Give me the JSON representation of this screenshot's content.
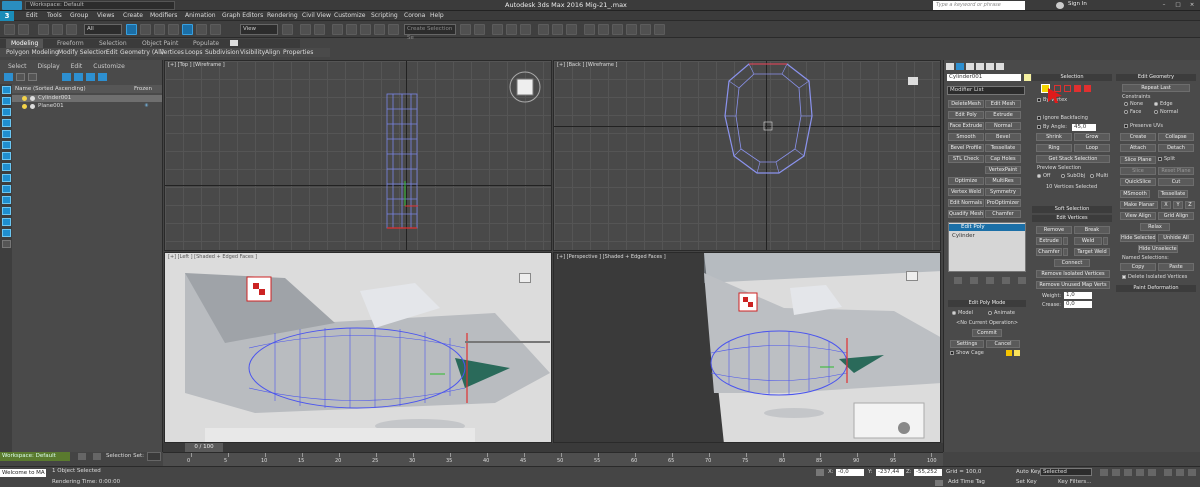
{
  "titlebar": {
    "workspace": "Workspace: Default",
    "title": "Autodesk 3ds Max 2016     Mig-21_.max",
    "search_placeholder": "Type a keyword or phrase",
    "sign_in": "Sign In"
  },
  "menu": {
    "logo": "3",
    "items": [
      "Edit",
      "Tools",
      "Group",
      "Views",
      "Create",
      "Modifiers",
      "Animation",
      "Graph Editors",
      "Rendering",
      "Civil View",
      "Customize",
      "Scripting",
      "Corona",
      "Help"
    ]
  },
  "toolbar": {
    "filter": "All",
    "ref_coord": "View",
    "named_sel": "Create Selection Se"
  },
  "ribbon": {
    "tabs": [
      "Modeling",
      "Freeform",
      "Selection",
      "Object Paint",
      "Populate"
    ],
    "sub": [
      "Polygon Modeling",
      "Modify Selection",
      "Edit",
      "Geometry (All)",
      "Vertices",
      "Loops",
      "Subdivision",
      "Visibility",
      "Align",
      "Properties"
    ]
  },
  "scene": {
    "menu": [
      "Select",
      "Display",
      "Edit",
      "Customize"
    ],
    "header_name": "Name (Sorted Ascending)",
    "header_frozen": "Frozen",
    "items": [
      "Cylinder001",
      "Plane001"
    ]
  },
  "viewports": {
    "top": "[+] [Top ] [Wireframe ]",
    "back": "[+] [Back ] [Wireframe ]",
    "left": "[+] [Left ] [Shaded + Edged Faces ]",
    "persp": "[+] [Perspective ] [Shaded + Edged Faces ]"
  },
  "cmd": {
    "object_name": "Cylinder001",
    "modifier_list": "Modifier List",
    "mod_buttons": [
      "DeleteMesh",
      "Edit Mesh",
      "Edit Poly",
      "Extrude",
      "Face Extrude",
      "Normal",
      "Smooth",
      "Bevel",
      "Bevel Profile",
      "Tessellate",
      "STL Check",
      "Cap Holes",
      "",
      "VertexPaint",
      "Optimize",
      "MultiRes",
      "Vertex Weld",
      "Symmetry",
      "Edit Normals",
      "ProOptimizer",
      "Quadify Mesh",
      "Chamfer"
    ],
    "stack": [
      "Edit Poly",
      "Cylinder"
    ],
    "epm_title": "Edit Poly Mode",
    "epm_model": "Model",
    "epm_animate": "Animate",
    "epm_noop": "<No Current Operation>",
    "epm_commit": "Commit",
    "epm_settings": "Settings",
    "epm_cancel": "Cancel",
    "epm_showcage": "Show Cage",
    "sel_title": "Selection",
    "sel_bvertex": "By Vertex",
    "sel_backface": "Ignore Backfacing",
    "sel_byangle": "By Angle:",
    "sel_angle": "45,0",
    "sel_shrink": "Shrink",
    "sel_grow": "Grow",
    "sel_ring": "Ring",
    "sel_loop": "Loop",
    "sel_getstack": "Get Stack Selection",
    "sel_preview": "Preview Selection",
    "sel_off": "Off",
    "sel_subobj": "SubObj",
    "sel_multi": "Multi",
    "sel_count": "10 Vertices Selected",
    "softsel": "Soft Selection",
    "editverts": "Edit Vertices",
    "ev_remove": "Remove",
    "ev_break": "Break",
    "ev_extrude": "Extrude",
    "ev_weld": "Weld",
    "ev_chamfer": "Chamfer",
    "ev_targetweld": "Target Weld",
    "ev_connect": "Connect",
    "ev_remiso": "Remove Isolated Vertices",
    "ev_remunused": "Remove Unused Map Verts",
    "ev_weight": "Weight:",
    "ev_weight_val": "1,0",
    "ev_crease": "Crease:",
    "ev_crease_val": "0,0",
    "eg_title": "Edit Geometry",
    "eg_repeat": "Repeat Last",
    "eg_constraints": "Constraints",
    "eg_none": "None",
    "eg_edge": "Edge",
    "eg_face": "Face",
    "eg_normal": "Normal",
    "eg_preserve": "Preserve UVs",
    "eg_create": "Create",
    "eg_collapse": "Collapse",
    "eg_attach": "Attach",
    "eg_detach": "Detach",
    "eg_slice": "Slice Plane",
    "eg_split": "Split",
    "eg_slice2": "Slice",
    "eg_reset": "Reset Plane",
    "eg_quickslice": "QuickSlice",
    "eg_cut": "Cut",
    "eg_msmooth": "MSmooth",
    "eg_tess": "Tessellate",
    "eg_makeplanar": "Make Planar",
    "eg_x": "X",
    "eg_y": "Y",
    "eg_z": "Z",
    "eg_viewalign": "View Align",
    "eg_gridalign": "Grid Align",
    "eg_relax": "Relax",
    "eg_hidesel": "Hide Selected",
    "eg_unhide": "Unhide All",
    "eg_hideunsel": "Hide Unselected",
    "eg_named": "Named Selections:",
    "eg_copy": "Copy",
    "eg_paste": "Paste",
    "eg_delete_iso": "Delete Isolated Vertices",
    "paint_def": "Paint Deformation"
  },
  "timeline": {
    "frame": "0 / 100",
    "ticks": [
      "0",
      "5",
      "10",
      "15",
      "20",
      "25",
      "30",
      "35",
      "40",
      "45",
      "50",
      "55",
      "60",
      "65",
      "70",
      "75",
      "80",
      "85",
      "90",
      "95",
      "100"
    ]
  },
  "status": {
    "workspace": "Workspace: Default",
    "selection_set": "Selection Set:",
    "objects": "1 Object Selected",
    "rendering": "Rendering Time: 0:00:00",
    "welcome": "Welcome to MA",
    "x_label": "X:",
    "x_val": "-0,0",
    "y_label": "Y:",
    "y_val": "-237,44",
    "z_label": "Z:",
    "z_val": "-55,252",
    "grid": "Grid = 100,0",
    "add_time_tag": "Add Time Tag",
    "auto_key": "Auto Key",
    "set_key": "Set Key",
    "selected": "Selected",
    "key_filters": "Key Filters..."
  },
  "colors": {
    "accent": "#1b6fa7",
    "red_marker": "#e02020",
    "workspace_green": "#5a7a2e"
  }
}
